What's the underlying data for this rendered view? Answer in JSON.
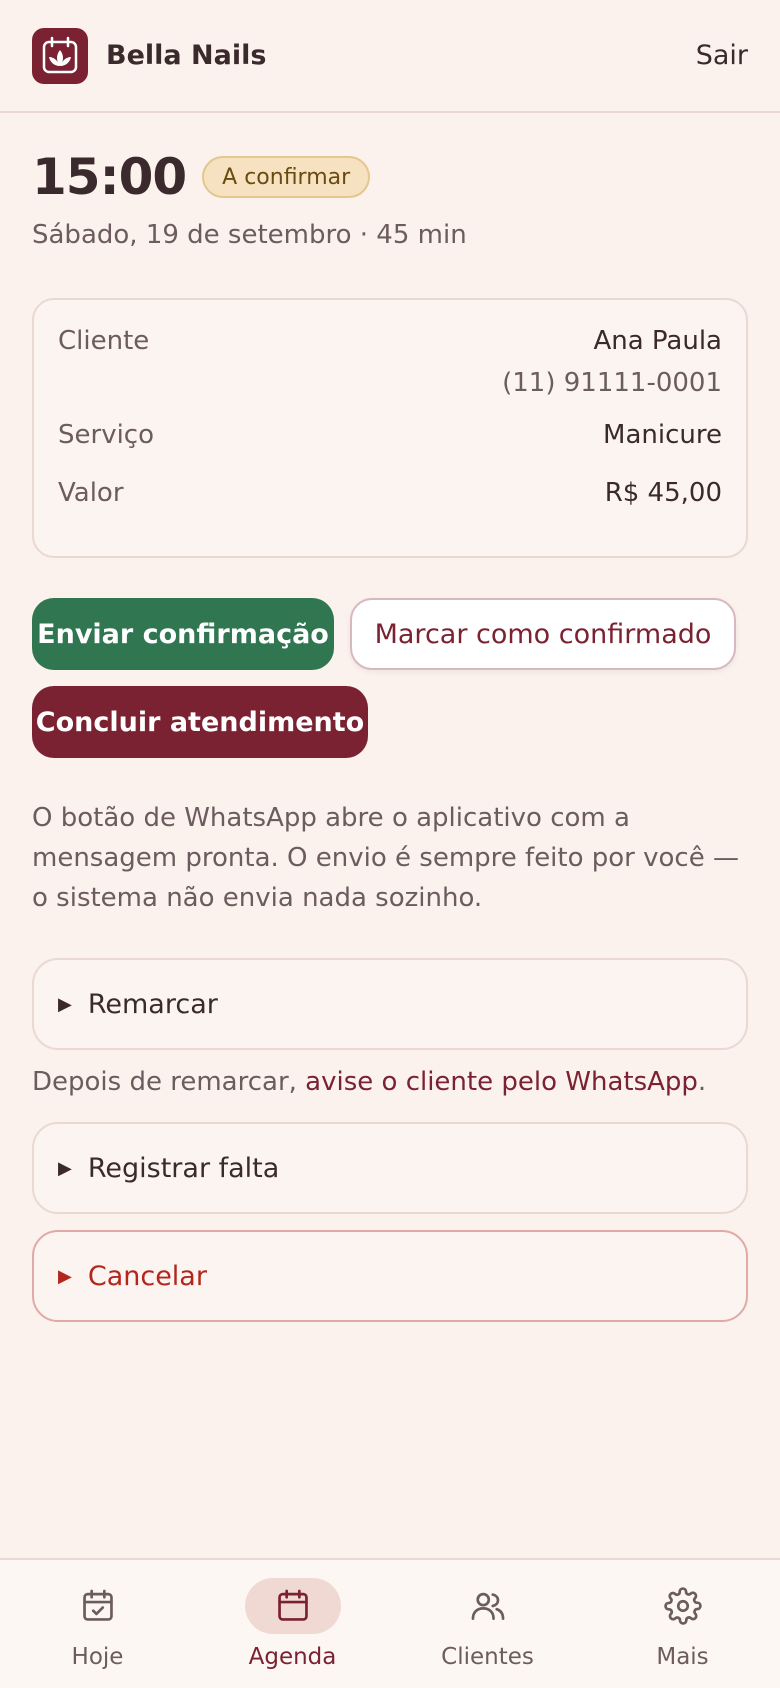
{
  "header": {
    "app_name": "Bella Nails",
    "logout_label": "Sair",
    "logo_icon": "lotus-calendar-icon"
  },
  "appointment": {
    "time": "15:00",
    "status": "A confirmar",
    "subtitle": "Sábado, 19 de setembro · 45 min"
  },
  "details": {
    "client_label": "Cliente",
    "client_name": "Ana Paula",
    "client_phone": "(11) 91111-0001",
    "service_label": "Serviço",
    "service_value": "Manicure",
    "price_label": "Valor",
    "price_value": "R$ 45,00"
  },
  "actions": {
    "send_confirmation": "Enviar confirmação",
    "mark_confirmed": "Marcar como confirmado",
    "complete": "Concluir atendimento"
  },
  "note": "O botão de WhatsApp abre o aplicativo com a mensagem pronta. O envio é sempre feito por você — o sistema não envia nada sozinho.",
  "sections": {
    "reschedule": "Remarcar",
    "reschedule_note_prefix": "Depois de remarcar,",
    "reschedule_note_link": "avise o cliente pelo WhatsApp",
    "reschedule_note_suffix": ".",
    "no_show": "Registrar falta",
    "cancel": "Cancelar"
  },
  "nav": {
    "items": [
      {
        "label": "Hoje",
        "icon": "calendar-check-icon",
        "active": false
      },
      {
        "label": "Agenda",
        "icon": "calendar-icon",
        "active": true
      },
      {
        "label": "Clientes",
        "icon": "users-icon",
        "active": false
      },
      {
        "label": "Mais",
        "icon": "gear-icon",
        "active": false
      }
    ]
  },
  "colors": {
    "brand": "#7b2232",
    "success": "#2f7651",
    "danger": "#b3261e",
    "background": "#fbf1ed"
  }
}
